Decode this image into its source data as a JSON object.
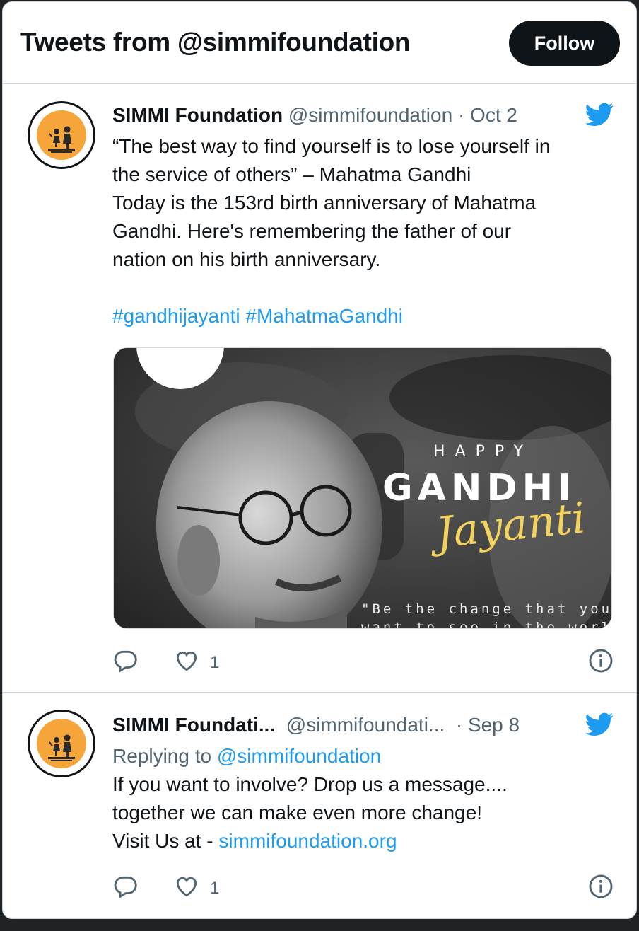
{
  "header": {
    "title": "Tweets from @simmifoundation",
    "follow_label": "Follow"
  },
  "tweets": [
    {
      "name": "SIMMI Foundation",
      "handle": "@simmifoundation",
      "separator": "·",
      "date": "Oct 2",
      "lines": [
        "“The best way to find yourself is to lose yourself in",
        "the service of others” – Mahatma Gandhi",
        "Today is the 153rd birth anniversary of Mahatma",
        "Gandhi. Here's remembering the father of our",
        "nation on his birth anniversary."
      ],
      "hashtags": "#gandhijayanti #MahatmaGandhi",
      "media": {
        "happy": "HAPPY",
        "gandhi": "GANDHI",
        "jayanti": "Jayanti",
        "quote_line1": "\"Be the change that you",
        "quote_line2": "want to see in the world\""
      },
      "like_count": "1",
      "icons": [
        "twitter-bird-icon",
        "reply-icon",
        "heart-icon",
        "info-icon"
      ]
    },
    {
      "name": "SIMMI Foundati...",
      "handle": "@simmifoundati...",
      "separator": "·",
      "date": "Sep 8",
      "replying_prefix": "Replying to",
      "replying_handle": "@simmifoundation",
      "lines": [
        "If you want to involve? Drop us a message....",
        "together we can make even more change!"
      ],
      "visit_prefix": "Visit Us at -",
      "visit_link": "simmifoundation.org",
      "like_count": "1",
      "icons": [
        "twitter-bird-icon",
        "reply-icon",
        "heart-icon",
        "info-icon"
      ]
    }
  ],
  "colors": {
    "accent": "#1d9bf0",
    "text": "#0f1419",
    "muted": "#536471",
    "button_bg": "#0f1419",
    "avatar_orange": "#f5a53a",
    "jayanti_gold": "#f3d35e"
  }
}
